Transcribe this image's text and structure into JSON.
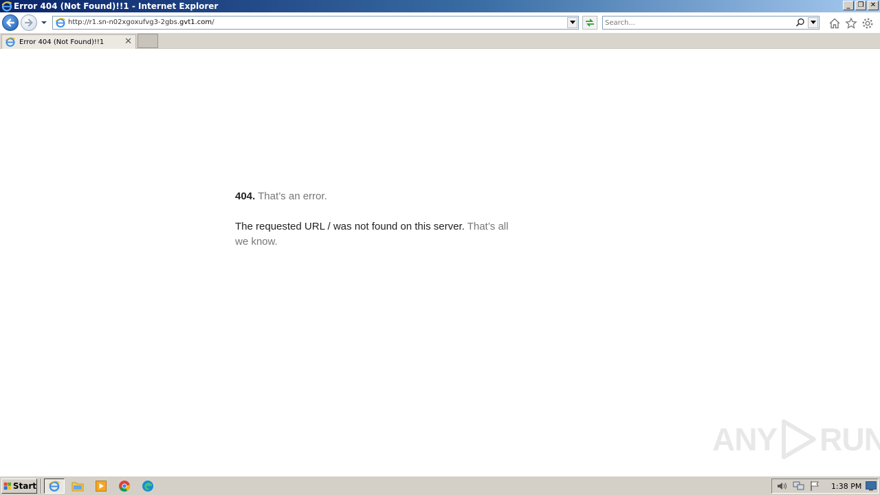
{
  "window": {
    "title": "Error 404 (Not Found)!!1 - Internet Explorer",
    "buttons": {
      "minimize": "_",
      "restore": "❐",
      "close": "✕"
    }
  },
  "toolbar": {
    "url_prefix": "http://r1.sn-n02xgoxufvg3-2gbs.",
    "url_host": "gvt1.com",
    "url_suffix": "/",
    "search_placeholder": "Search..."
  },
  "tabs": [
    {
      "title": "Error 404 (Not Found)!!1",
      "close": "✕"
    }
  ],
  "page": {
    "code": "404.",
    "code_message": "That’s an error.",
    "message": "The requested URL / was not found on this server.",
    "message_tail": "That’s all we know."
  },
  "watermark": {
    "left": "ANY",
    "right": "RUN"
  },
  "taskbar": {
    "start_label": "Start",
    "apps": [
      "internet-explorer",
      "file-explorer",
      "media-player",
      "chrome",
      "edge"
    ],
    "clock": "1:38 PM"
  },
  "colors": {
    "titlebar_start": "#0a246a",
    "titlebar_end": "#a6caf0",
    "taskbar": "#d4d0c8",
    "muted_text": "#777777"
  }
}
